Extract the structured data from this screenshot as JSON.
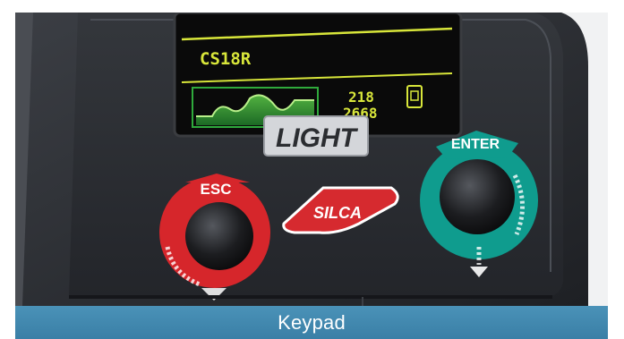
{
  "display": {
    "model": "CS18R",
    "count_top": "218",
    "count_bottom": "2668"
  },
  "panel": {
    "brand_badge": "LIGHT",
    "logo": "SILCA"
  },
  "buttons": {
    "esc_label": "ESC",
    "enter_label": "ENTER"
  },
  "caption": {
    "label": "Keypad"
  },
  "colors": {
    "caption_bar": "#3f86ad",
    "esc_knob": "#d6262b",
    "enter_knob": "#0f9c8e",
    "oled_text": "#d8e63a",
    "oled_graph": "#2faa3c",
    "device_body": "#2a2c30"
  }
}
